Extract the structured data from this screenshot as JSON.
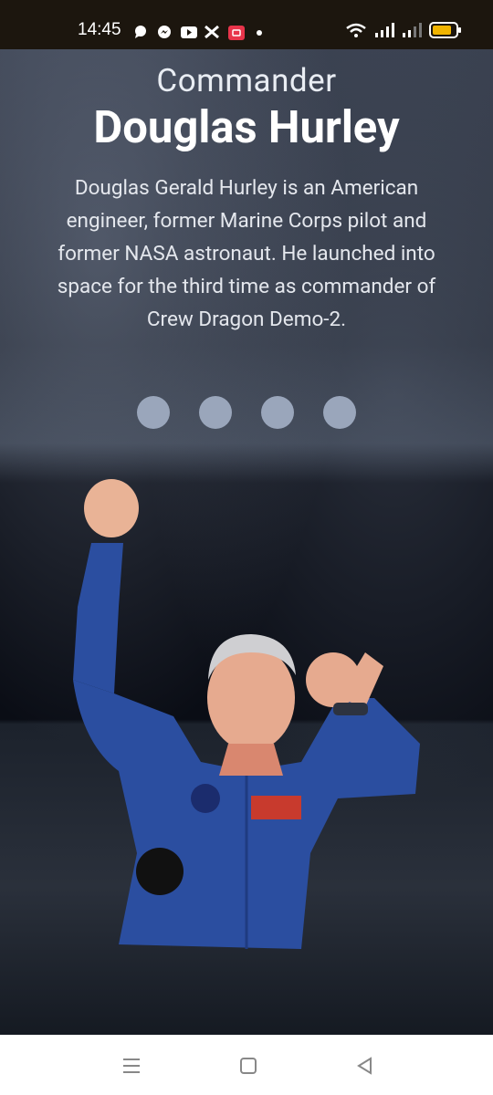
{
  "status_bar": {
    "time": "14:45",
    "left_icons": [
      "chat-icon",
      "messenger-icon",
      "youtube-icon",
      "x-icon",
      "screen-record-icon",
      "dot-icon"
    ],
    "right_icons": [
      "wifi-icon",
      "signal-icon",
      "signal2-icon",
      "battery-icon"
    ],
    "battery_color": "#f0b400"
  },
  "hero": {
    "subtitle": "Commander",
    "title": "Douglas Hurley",
    "description": "Douglas Gerald Hurley is an American engineer, former Marine Corps pilot and former NASA astronaut. He launched into space for the third time as commander of Crew Dragon Demo-2.",
    "dots_count": 4,
    "dot_color": "#9aa6bb"
  },
  "image": {
    "description_icon": "astronaut-photo",
    "suit_color": "#2b4ea0"
  },
  "nav_bar": {
    "items": [
      "menu-icon",
      "home-icon",
      "back-icon"
    ]
  }
}
